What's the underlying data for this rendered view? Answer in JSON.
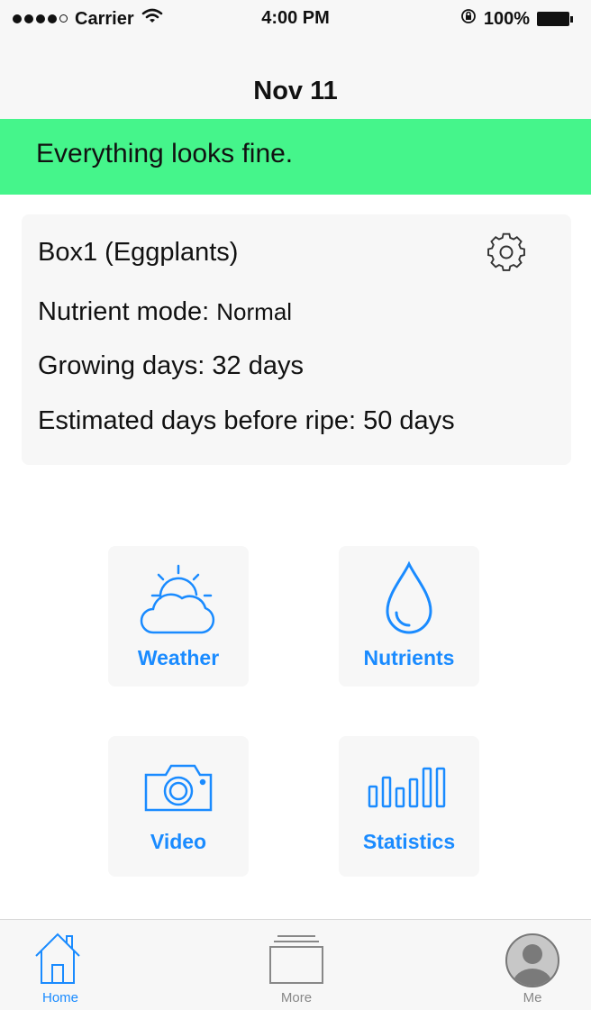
{
  "status_bar": {
    "carrier": "Carrier",
    "time": "4:00 PM",
    "battery": "100%"
  },
  "nav": {
    "title": "Nov 11"
  },
  "alert": {
    "message": "Everything looks fine."
  },
  "box": {
    "title": "Box1 (Eggplants)",
    "nutrient_mode_label": "Nutrient mode:",
    "nutrient_mode_value": "Normal",
    "growing_days_label": "Growing days:",
    "growing_days_value": "32 days",
    "ripe_label": "Estimated days before ripe:",
    "ripe_value": "50 days"
  },
  "tiles": [
    {
      "label": "Weather",
      "icon": "weather-icon"
    },
    {
      "label": "Nutrients",
      "icon": "water-drop-icon"
    },
    {
      "label": "Video",
      "icon": "camera-icon"
    },
    {
      "label": "Statistics",
      "icon": "bar-chart-icon"
    }
  ],
  "tab_bar": {
    "items": [
      {
        "label": "Home",
        "icon": "home-icon",
        "active": true
      },
      {
        "label": "More",
        "icon": "more-icon",
        "active": false
      },
      {
        "label": "Me",
        "icon": "profile-icon",
        "active": false
      }
    ]
  },
  "colors": {
    "accent": "#1a8bff",
    "alert_background": "#45f58b",
    "card_background": "#f7f7f7"
  }
}
